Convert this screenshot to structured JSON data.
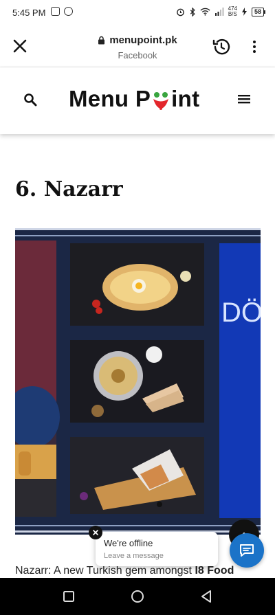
{
  "status_bar": {
    "time": "5:45 PM",
    "net_speed_top": "474",
    "net_speed_bottom": "B/S",
    "battery": "58"
  },
  "browser": {
    "url": "menupoint.pk",
    "subtitle": "Facebook",
    "icons": [
      "close-icon",
      "lock-icon",
      "history-icon",
      "more-vertical-icon"
    ]
  },
  "site_header": {
    "logo_left": "Menu P",
    "logo_right": "int",
    "icons": [
      "search-icon",
      "hamburger-menu-icon"
    ]
  },
  "article": {
    "title": "6. Nazarr",
    "hero_sign_text": "DÖ",
    "text_plain": "Nazarr: A new Turkish gem amongst ",
    "text_bold": "I8 Food"
  },
  "chat": {
    "offline_title": "We're offline",
    "offline_sub": "Leave a message"
  },
  "colors": {
    "chat_blue": "#1b73c8",
    "hero_navy": "#1a2540",
    "logo_red": "#e3262b",
    "logo_green": "#3aa53f"
  }
}
